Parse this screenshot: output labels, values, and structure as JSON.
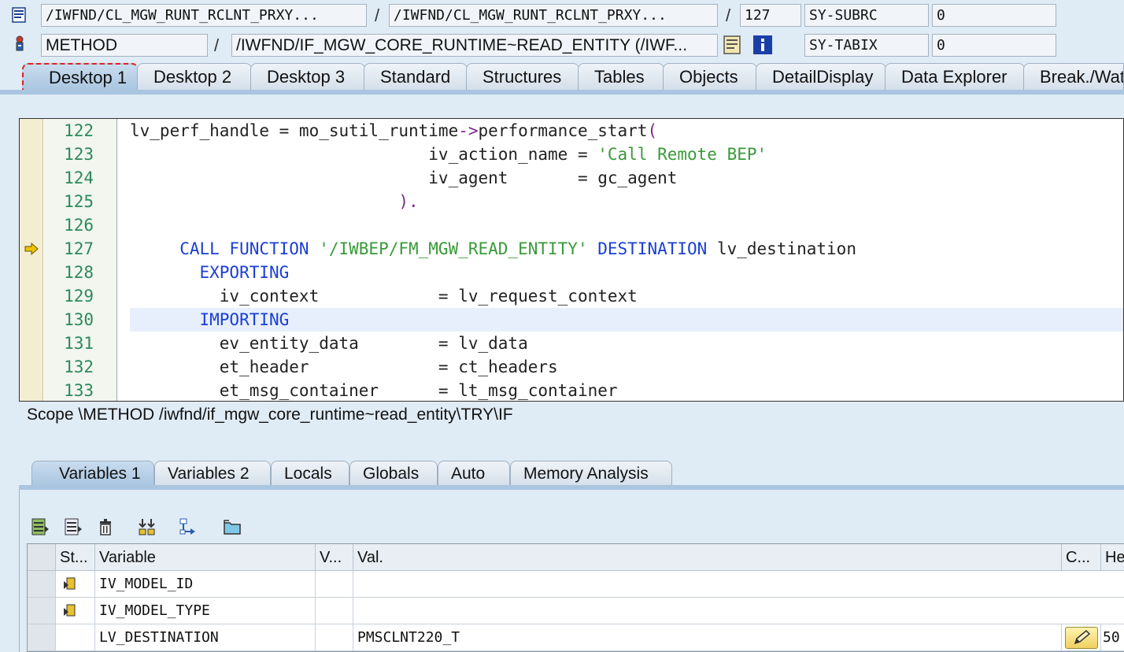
{
  "header": {
    "row1": {
      "program": "/IWFND/CL_MGW_RUNT_RCLNT_PRXY...",
      "include": "/IWFND/CL_MGW_RUNT_RCLNT_PRXY...",
      "line": "127",
      "sysfield1_name": "SY-SUBRC",
      "sysfield1_value": "0",
      "sep": "/"
    },
    "row2": {
      "event_type": "METHOD",
      "event_name": "/IWFND/IF_MGW_CORE_RUNTIME~READ_ENTITY (/IWF...",
      "sysfield2_name": "SY-TABIX",
      "sysfield2_value": "0",
      "sep": "/"
    }
  },
  "desktop_tabs": [
    "Desktop 1",
    "Desktop 2",
    "Desktop 3",
    "Standard",
    "Structures",
    "Tables",
    "Objects",
    "DetailDisplay",
    "Data Explorer",
    "Break./Watch"
  ],
  "code": {
    "lines": [
      {
        "num": "122",
        "indent": "     ",
        "parts": [
          [
            "",
            "lv_perf_handle = mo_sutil_runtime"
          ],
          [
            "pun",
            "->"
          ],
          [
            "",
            "performance_start"
          ],
          [
            "pun",
            "("
          ]
        ]
      },
      {
        "num": "123",
        "indent": "",
        "parts": [
          [
            "",
            "                              iv_action_name = "
          ],
          [
            "str",
            "'Call Remote BEP'"
          ]
        ]
      },
      {
        "num": "124",
        "indent": "",
        "parts": [
          [
            "",
            "                              iv_agent       = gc_agent"
          ]
        ]
      },
      {
        "num": "125",
        "indent": "",
        "parts": [
          [
            "pun",
            "                           )."
          ]
        ]
      },
      {
        "num": "126",
        "indent": "",
        "parts": [
          [
            "",
            ""
          ]
        ]
      },
      {
        "num": "127",
        "indent": "",
        "parts": [
          [
            "kw",
            "     CALL FUNCTION "
          ],
          [
            "str",
            "'/IWBEP/FM_MGW_READ_ENTITY'"
          ],
          [
            "kw",
            " DESTINATION"
          ],
          [
            "",
            " lv_destination"
          ]
        ]
      },
      {
        "num": "128",
        "indent": "",
        "parts": [
          [
            "kw",
            "       EXPORTING"
          ]
        ]
      },
      {
        "num": "129",
        "indent": "",
        "parts": [
          [
            "",
            "         iv_context            = lv_request_context"
          ]
        ]
      },
      {
        "num": "130",
        "indent": "",
        "parts": [
          [
            "kw",
            "       IMPORTING"
          ]
        ]
      },
      {
        "num": "131",
        "indent": "",
        "parts": [
          [
            "",
            "         ev_entity_data        = lv_data"
          ]
        ]
      },
      {
        "num": "132",
        "indent": "",
        "parts": [
          [
            "",
            "         et_header             = ct_headers"
          ]
        ]
      },
      {
        "num": "133",
        "indent": "",
        "parts": [
          [
            "",
            "         et_msg_container      = lt_msg_container"
          ]
        ]
      }
    ]
  },
  "scope_text": "Scope \\METHOD /iwfnd/if_mgw_core_runtime~read_entity\\TRY\\IF",
  "variable_tabs": [
    "Variables 1",
    "Variables 2",
    "Locals",
    "Globals",
    "Auto",
    "Memory Analysis"
  ],
  "table": {
    "headers": [
      "St...",
      "Variable",
      "V...",
      "Val.",
      "C...",
      "He"
    ],
    "rows": [
      {
        "variable": "IV_MODEL_ID",
        "value": ""
      },
      {
        "variable": "IV_MODEL_TYPE",
        "value": ""
      },
      {
        "variable": "LV_DESTINATION",
        "value": "PMSCLNT220_T",
        "hex": "50"
      }
    ]
  }
}
